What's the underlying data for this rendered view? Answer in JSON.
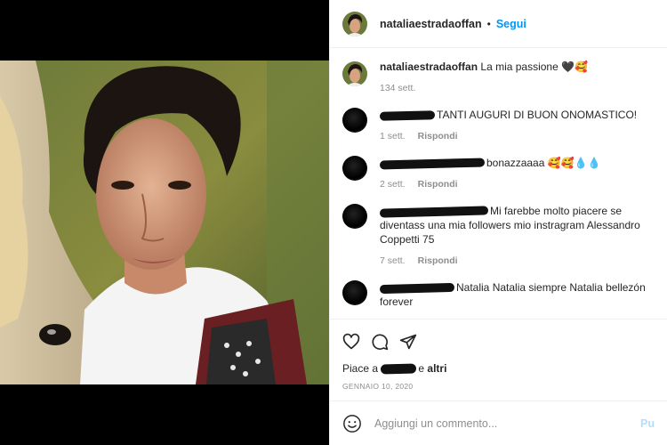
{
  "post": {
    "username": "nataliaestradaoffan",
    "dot": "•",
    "follow_label": "Segui"
  },
  "caption": {
    "username": "nataliaestradaoffan",
    "text": "La mia passione 🖤🥰",
    "time": "134 sett."
  },
  "comments": [
    {
      "text": "TANTI AUGURI DI BUON ONOMASTICO!",
      "time": "1 sett.",
      "reply": "Rispondi"
    },
    {
      "text": "bonazzaaaa 🥰🥰💧💧",
      "time": "2 sett.",
      "reply": "Rispondi"
    },
    {
      "text": "Mi farebbe molto piacere se diventass una mia followers mio instragram Alessandro Coppetti 75",
      "time": "7 sett.",
      "reply": "Rispondi"
    },
    {
      "text": "Natalia Natalia siempre Natalia bellezón forever",
      "time": "",
      "reply": ""
    }
  ],
  "likes": {
    "prefix": "Piace a",
    "suffix": "e",
    "others": "altri"
  },
  "date": "GENNAIO 10, 2020",
  "add_comment": {
    "placeholder": "Aggiungi un commento...",
    "post_label": "Pu"
  },
  "icons": [
    "heart-icon",
    "comment-icon",
    "share-icon",
    "emoji-icon"
  ],
  "colors": {
    "accent": "#0095f6",
    "muted": "#8e8e8e",
    "border": "#efefef"
  }
}
